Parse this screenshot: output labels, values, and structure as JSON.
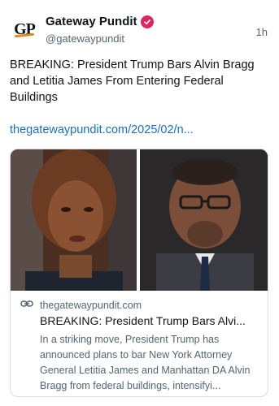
{
  "post": {
    "author_name": "Gateway Pundit",
    "author_handle": "@gatewaypundit",
    "timestamp": "1h",
    "avatar_text": "GP",
    "text": "BREAKING: President Trump Bars Alvin Bragg and Letitia James From Entering Federal Buildings",
    "link_text": "thegatewaypundit.com/2025/02/n..."
  },
  "card": {
    "domain": "thegatewaypundit.com",
    "title": "BREAKING: President Trump Bars Alvi...",
    "description": "In a striking move, President Trump has announced plans to bar New York Attorney General Letitia James and Manhattan DA Alvin Bragg from federal buildings, intensifyi..."
  },
  "colors": {
    "link": "#1d6fb8",
    "verified_badge": "#e0245e",
    "muted_text": "#536471"
  },
  "icons": [
    "verified-badge-icon",
    "link-icon"
  ]
}
